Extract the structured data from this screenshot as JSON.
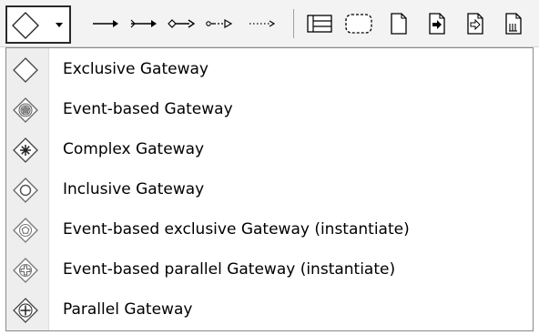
{
  "toolbar": {
    "gateway_dropdown": {
      "icon": "diamond-gateway-icon",
      "arrow_icon": "dropdown-arrow-icon"
    },
    "buttons": [
      {
        "name": "sequence-flow-icon"
      },
      {
        "name": "message-flow-icon"
      },
      {
        "name": "association-icon"
      },
      {
        "name": "directed-association-icon"
      },
      {
        "name": "dotted-association-icon"
      },
      {
        "name": "pool-lane-icon"
      },
      {
        "name": "group-icon"
      },
      {
        "name": "data-object-icon"
      },
      {
        "name": "data-input-icon"
      },
      {
        "name": "data-output-icon"
      },
      {
        "name": "data-store-icon"
      }
    ]
  },
  "menu": {
    "items": [
      {
        "label": "Exclusive Gateway",
        "icon": "exclusive-gateway-icon"
      },
      {
        "label": "Event-based Gateway",
        "icon": "event-based-gateway-icon"
      },
      {
        "label": "Complex Gateway",
        "icon": "complex-gateway-icon"
      },
      {
        "label": "Inclusive Gateway",
        "icon": "inclusive-gateway-icon"
      },
      {
        "label": "Event-based exclusive Gateway (instantiate)",
        "icon": "event-based-exclusive-gateway-icon"
      },
      {
        "label": "Event-based parallel Gateway (instantiate)",
        "icon": "event-based-parallel-gateway-icon"
      },
      {
        "label": "Parallel Gateway",
        "icon": "parallel-gateway-icon"
      }
    ]
  },
  "colors": {
    "toolbar_bg": "#f3f3f3",
    "icon_strip": "#eeeeee",
    "dropdown_border": "#2a2a2a",
    "text": "#000000"
  }
}
